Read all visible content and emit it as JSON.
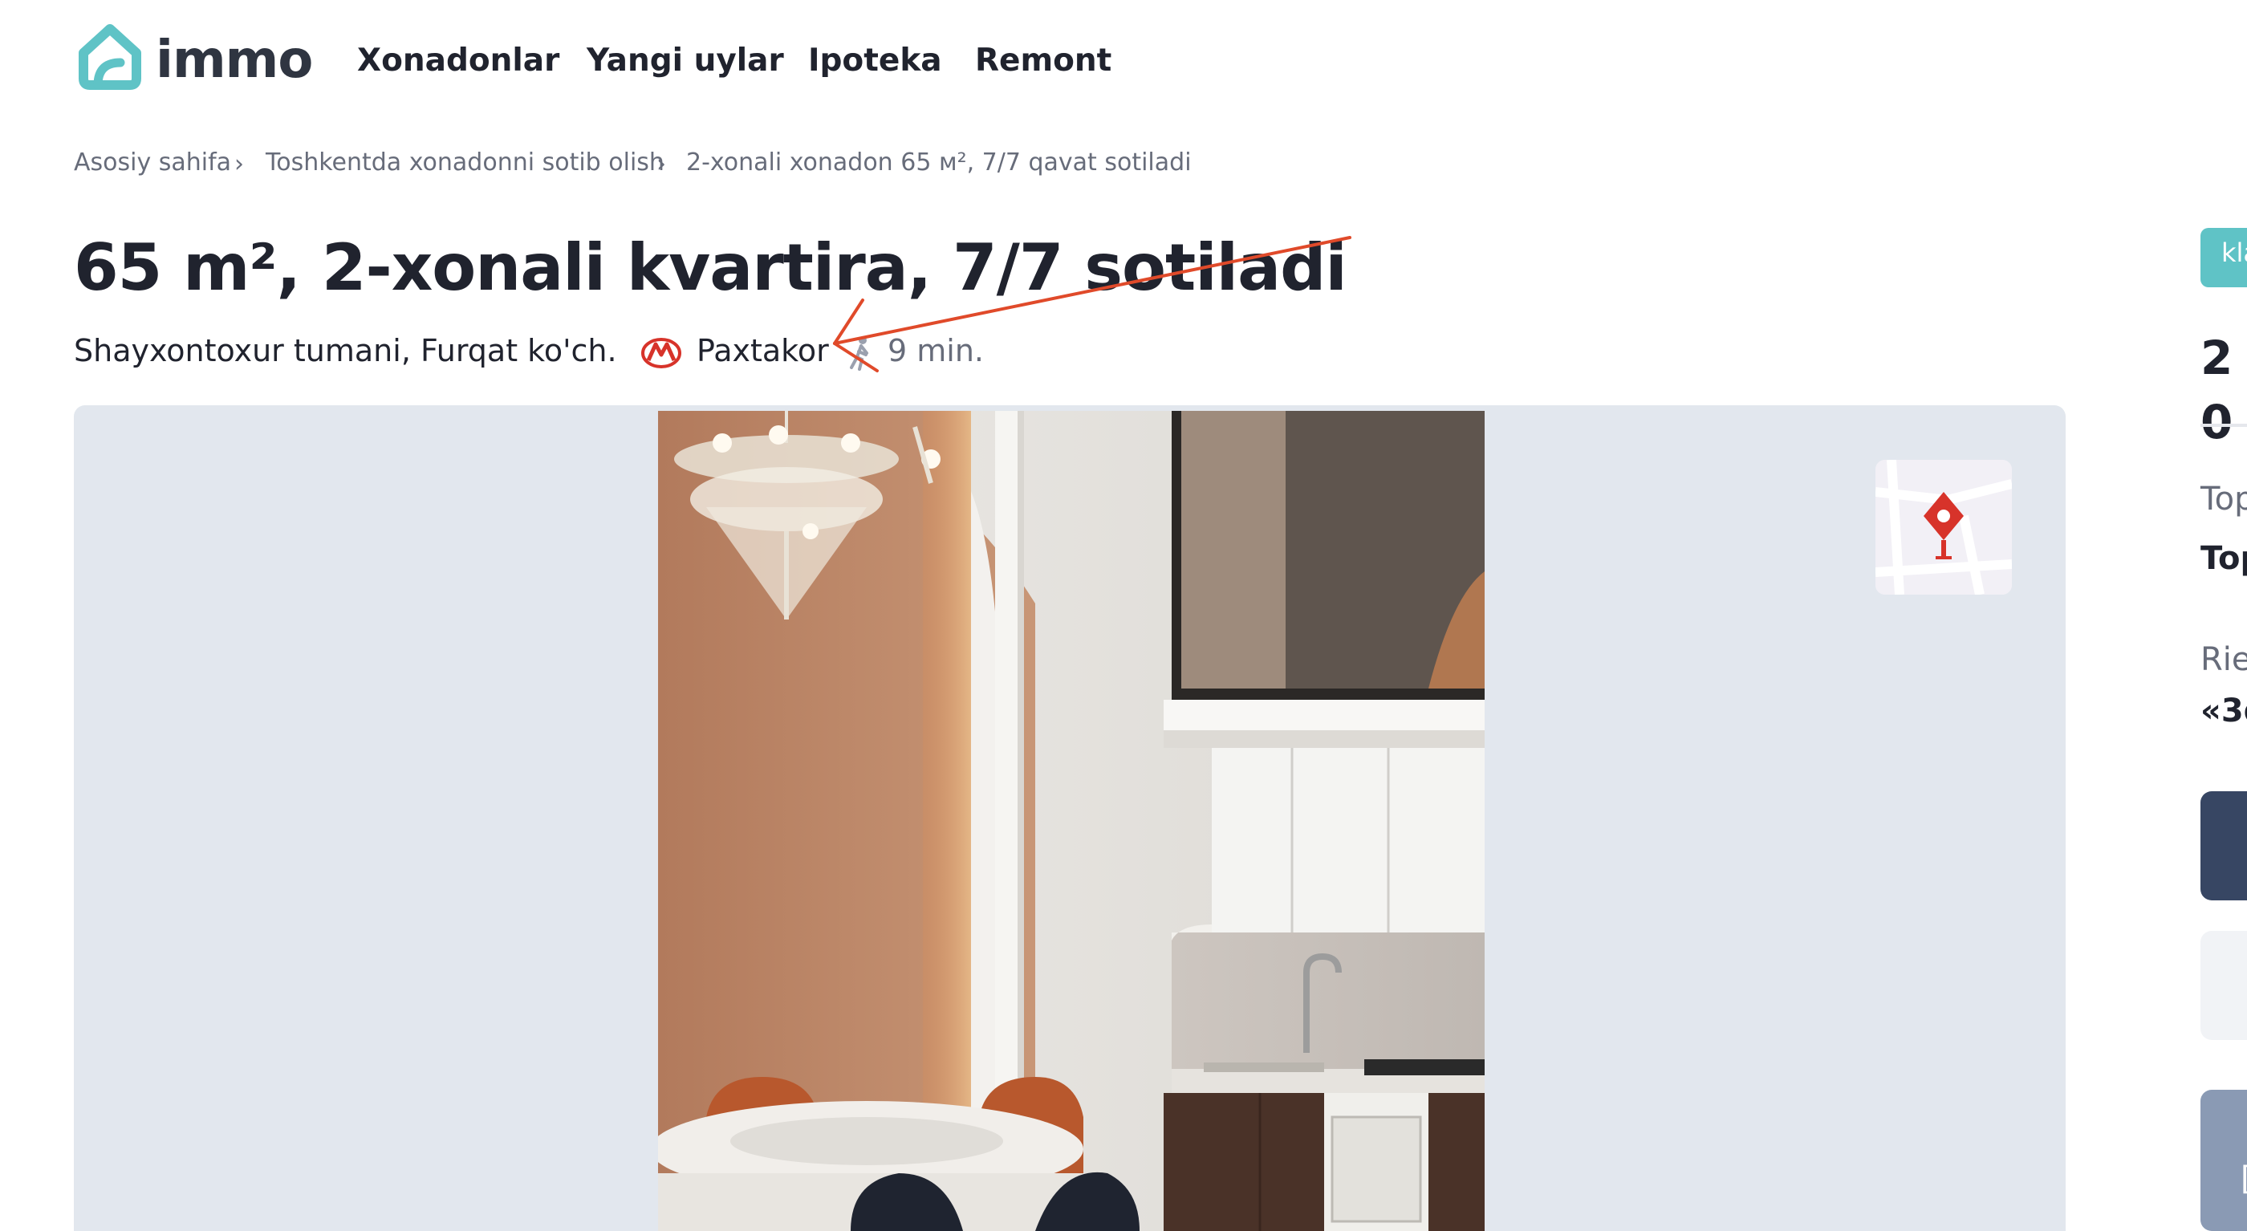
{
  "header": {
    "logo_text": "immo",
    "nav": [
      "Xonadonlar",
      "Yangi uylar",
      "Ipoteka",
      "Remont"
    ]
  },
  "breadcrumb": {
    "items": [
      "Asosiy sahifa",
      "Toshkentda xonadonni sotib olish",
      "2-xonali xonadon 65 м², 7/7 qavat sotiladi"
    ],
    "separator": "›"
  },
  "listing": {
    "title": "65 m², 2-xonali kvartira, 7/7 sotiladi",
    "address": "Shayxontoxur tumani, Furqat ko'ch.",
    "metro_station": "Paxtakor",
    "walk_time": "9 min."
  },
  "sidebar": {
    "tag": "kla",
    "price": "2 0",
    "label1": "Top",
    "value1": "Top",
    "label2": "Rie",
    "value2": "«3d",
    "button3": "["
  },
  "icons": {
    "logo": "house-logo-icon",
    "metro": "metro-icon",
    "walk": "walking-person-icon",
    "map": "map-pin-icon"
  },
  "colors": {
    "brand": "#5fc3c6",
    "metro_red": "#d7332a",
    "annotation": "#e04a2a",
    "gallery_bg": "#e2e7ee"
  }
}
